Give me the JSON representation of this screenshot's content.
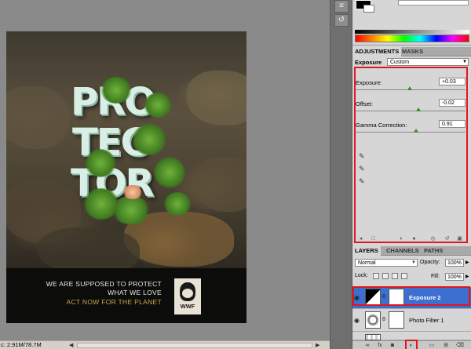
{
  "poster": {
    "letters": [
      "PRO",
      "TEC",
      "TOR"
    ],
    "line1": "WE ARE SUPPOSED TO PROTECT",
    "line2": "WHAT WE LOVE",
    "line3": "ACT NOW FOR THE PLANET",
    "logo_text": "WWF"
  },
  "status": {
    "doc_info": "c: 2.91M/78.7M"
  },
  "adjustments": {
    "tabs": [
      "ADJUSTMENTS",
      "MASKS"
    ],
    "preset_label": "Exposure",
    "preset_value": "Custom",
    "fields": [
      {
        "label": "Exposure:",
        "value": "+0.03"
      },
      {
        "label": "Offset:",
        "value": "-0.02"
      },
      {
        "label": "Gamma Correction:",
        "value": "0.91"
      }
    ]
  },
  "layers": {
    "tabs": [
      "LAYERS",
      "CHANNELS",
      "PATHS"
    ],
    "blend_mode": "Normal",
    "opacity_label": "Opacity:",
    "opacity_value": "100%",
    "lock_label": "Lock:",
    "fill_label": "Fill:",
    "fill_value": "100%",
    "items": [
      {
        "name": "Exposure 2",
        "selected": true
      },
      {
        "name": "Photo Filter 1",
        "selected": false
      }
    ]
  },
  "colors": {
    "highlight_red": "#e0171d",
    "layer_selected": "#3d6fd0"
  }
}
